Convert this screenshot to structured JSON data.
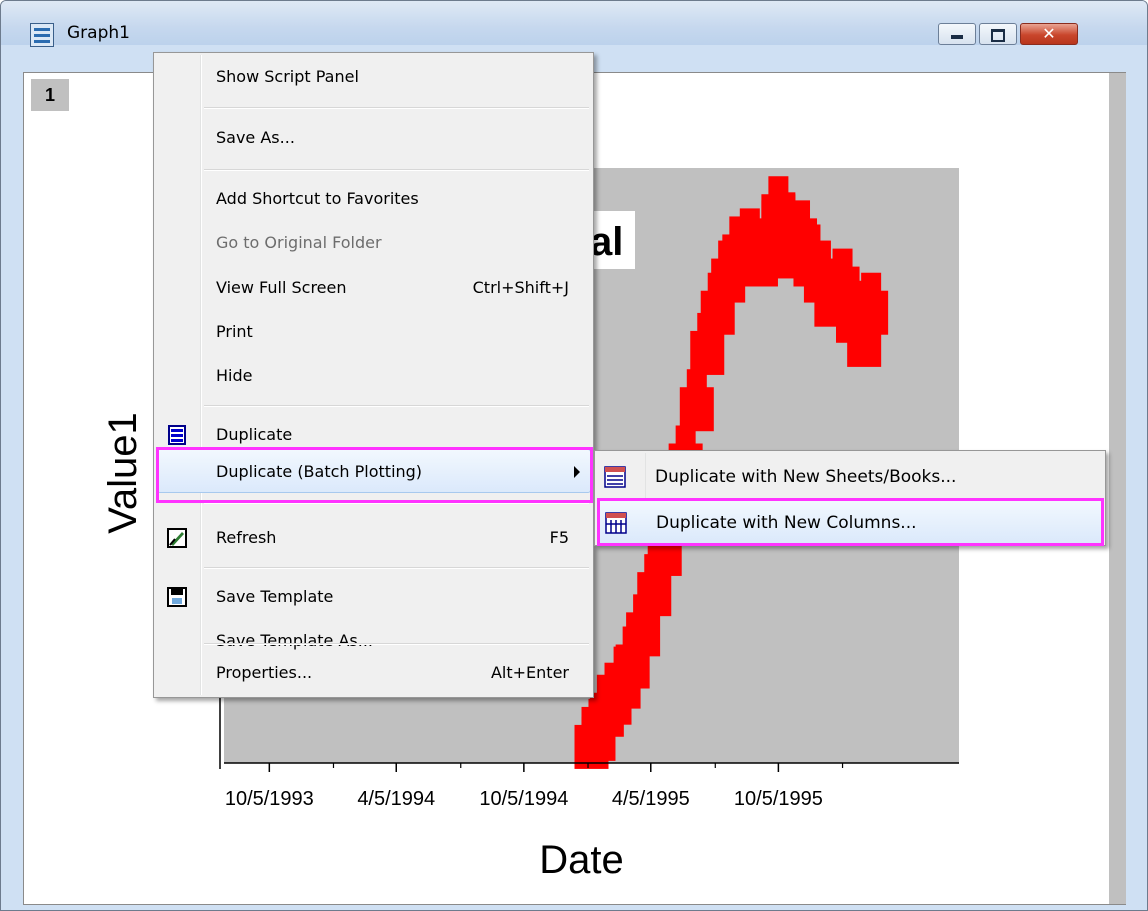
{
  "window": {
    "title": "Graph1",
    "layer_tab": "1"
  },
  "chart_data": {
    "type": "scatter",
    "title_fragment": "al",
    "xlabel": "Date",
    "ylabel": "Value1",
    "x_tick_labels": [
      "10/5/1993",
      "4/5/1994",
      "10/5/1994",
      "4/5/1995",
      "10/5/1995"
    ],
    "series": [
      {
        "name": "",
        "color": "#ff0000",
        "marker": "square",
        "x": [
          "1995-01-10",
          "1995-01-20",
          "1995-02-01",
          "1995-02-12",
          "1995-02-25",
          "1995-03-10",
          "1995-03-25",
          "1995-04-10",
          "1995-04-25",
          "1995-05-10",
          "1995-05-25",
          "1995-06-10",
          "1995-06-25",
          "1995-07-10",
          "1995-07-25",
          "1995-08-10",
          "1995-08-25",
          "1995-09-10",
          "1995-09-25",
          "1995-10-05",
          "1995-10-15",
          "1995-10-25",
          "1995-11-05",
          "1995-11-20",
          "1995-12-05",
          "1995-12-20",
          "1996-01-05",
          "1996-01-20",
          "1996-02-05",
          "1996-02-15"
        ],
        "y": [
          0.2,
          0.3,
          0.6,
          0.75,
          0.95,
          1.2,
          1.6,
          2.1,
          2.6,
          3.1,
          3.7,
          4.4,
          5.1,
          5.6,
          6.0,
          6.3,
          6.4,
          6.2,
          6.5,
          6.8,
          6.6,
          6.3,
          6.5,
          6.2,
          6.0,
          5.7,
          5.9,
          5.5,
          5.2,
          5.6
        ]
      }
    ],
    "plot_background": "#c0c0c0"
  },
  "context_menu": {
    "items": [
      {
        "label": "Show Script Panel",
        "shortcut": ""
      },
      {
        "label": "Save As...",
        "shortcut": ""
      },
      {
        "label": "Add Shortcut to Favorites",
        "shortcut": ""
      },
      {
        "label": "Go to Original Folder",
        "shortcut": ""
      },
      {
        "label": "View Full Screen",
        "shortcut": "Ctrl+Shift+J"
      },
      {
        "label": "Print",
        "shortcut": ""
      },
      {
        "label": "Hide",
        "shortcut": ""
      },
      {
        "label": "Duplicate",
        "shortcut": ""
      },
      {
        "label": "Duplicate (Batch Plotting)",
        "shortcut": ""
      },
      {
        "label": "Refresh",
        "shortcut": "F5"
      },
      {
        "label": "Save Template",
        "shortcut": ""
      },
      {
        "label": "Save Template As...",
        "shortcut": ""
      },
      {
        "label": "Properties...",
        "shortcut": "Alt+Enter"
      }
    ]
  },
  "submenu": {
    "items": [
      {
        "label": "Duplicate with New Sheets/Books..."
      },
      {
        "label": "Duplicate with New Columns..."
      }
    ]
  },
  "colors": {
    "highlight_outline": "#ff33ff",
    "data_marker": "#ff0000"
  }
}
